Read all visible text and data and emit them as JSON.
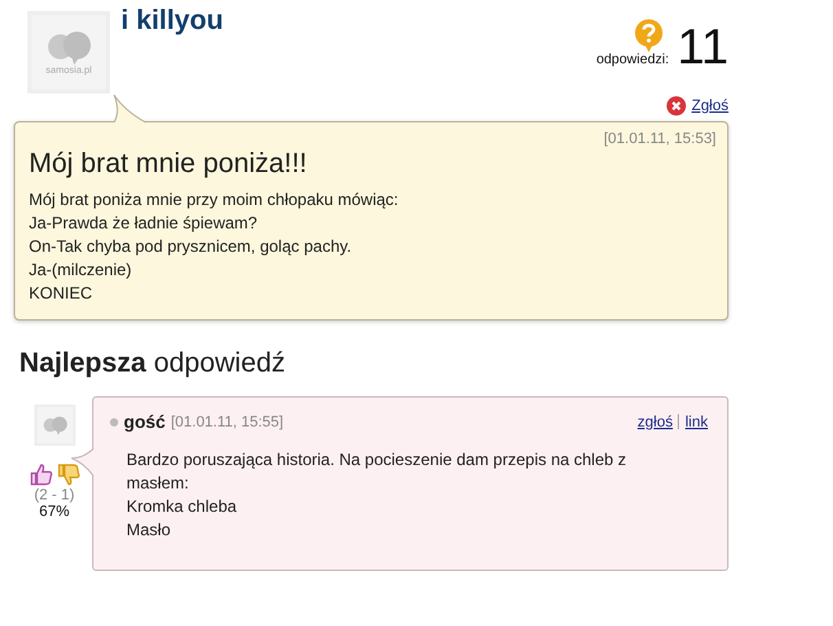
{
  "question": {
    "avatar_label": "samosia.pl",
    "author": "i killyou",
    "answers_label": "odpowiedzi:",
    "answers_count": "11",
    "report": "Zgłoś",
    "date": "[01.01.11, 15:53]",
    "title": "Mój brat mnie poniża!!!",
    "body": [
      "Mój brat poniża mnie przy moim chłopaku mówiąc:",
      "Ja-Prawda że ładnie śpiewam?",
      "On-Tak chyba pod prysznicem, goląc pachy.",
      "Ja-(milczenie)",
      "KONIEC"
    ]
  },
  "best_heading": "**Najlepsza** odpowiedź",
  "answer": {
    "votes": "(2 - 1)",
    "percent": "67%",
    "author": "gość",
    "date": "[01.01.11, 15:55]",
    "links": [
      "zgłoś",
      "link"
    ],
    "body": [
      "Bardzo poruszająca historia. Na pocieszenie dam przepis na chleb z masłem:",
      "Kromka chleba",
      "Masło"
    ]
  }
}
